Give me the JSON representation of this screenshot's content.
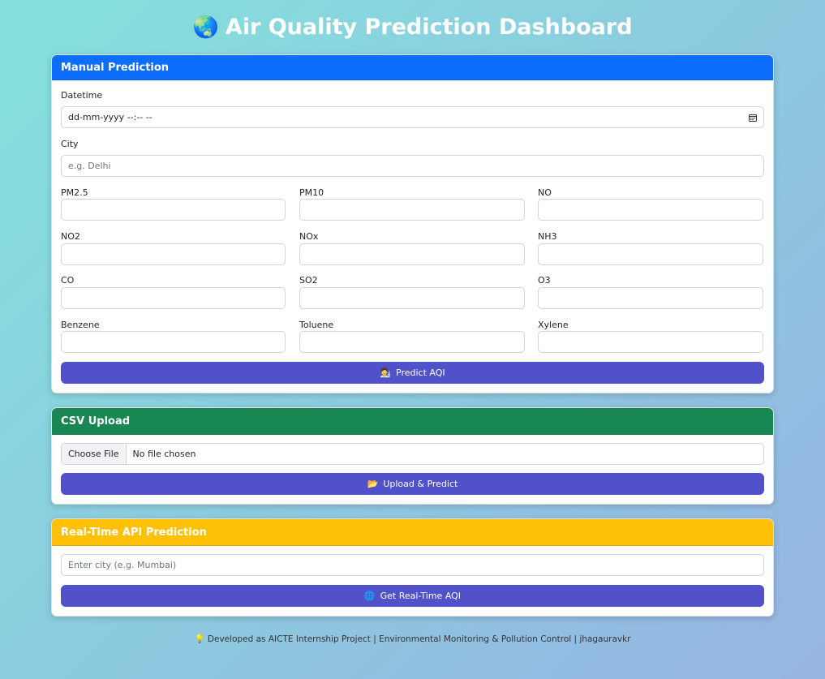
{
  "header": {
    "globe_icon": "🌏",
    "title": "Air Quality Prediction Dashboard"
  },
  "manual": {
    "title": "Manual Prediction",
    "header_color": "#0d6efd",
    "datetime_label": "Datetime",
    "datetime_value": "dd-mm-yyyy --:--  --",
    "city_label": "City",
    "city_placeholder": "e.g. Delhi",
    "fields": [
      {
        "label": "PM2.5"
      },
      {
        "label": "PM10"
      },
      {
        "label": "NO"
      },
      {
        "label": "NO2"
      },
      {
        "label": "NOx"
      },
      {
        "label": "NH3"
      },
      {
        "label": "CO"
      },
      {
        "label": "SO2"
      },
      {
        "label": "O3"
      },
      {
        "label": "Benzene"
      },
      {
        "label": "Toluene"
      },
      {
        "label": "Xylene"
      }
    ],
    "button_icon": "🧑‍🔬",
    "button_label": "Predict AQI"
  },
  "csv": {
    "title": "CSV Upload",
    "header_color": "#198754",
    "choose_label": "Choose File",
    "file_status": "No file chosen",
    "button_icon": "📂",
    "button_label": "Upload & Predict"
  },
  "realtime": {
    "title": "Real-Time API Prediction",
    "header_color": "#ffc107",
    "city_placeholder": "Enter city (e.g. Mumbai)",
    "button_icon": "🌐",
    "button_label": "Get Real-Time AQI"
  },
  "footer": {
    "icon": "💡",
    "text": "Developed as AICTE Internship Project | Environmental Monitoring & Pollution Control | jhagauravkr"
  },
  "colors": {
    "button": "#5151c9"
  }
}
